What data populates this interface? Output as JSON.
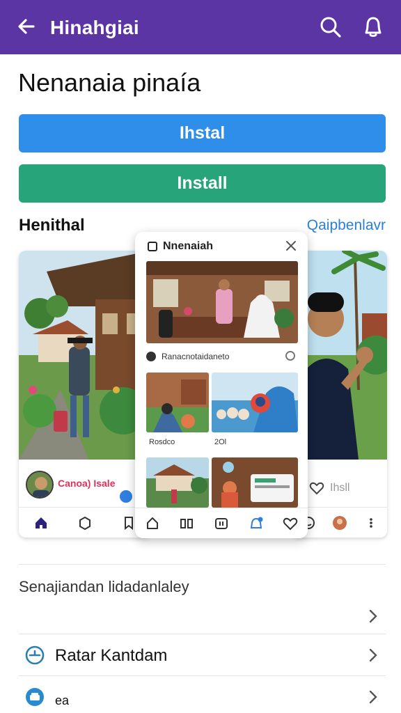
{
  "appbar": {
    "title": "Hinahgiai",
    "background": "#5b35a3",
    "icons": [
      "arrow-left-icon",
      "search-icon",
      "bell-icon"
    ]
  },
  "page": {
    "title": "Nenanaia pinaía"
  },
  "buttons": {
    "primary": {
      "label": "Ihstal",
      "color": "#2f8eea"
    },
    "secondary": {
      "label": "Install",
      "color": "#28a47a"
    }
  },
  "section": {
    "title": "Henithal",
    "link": "Qaipbenlavr"
  },
  "previews": {
    "left": {
      "username": "Canoa) Isale",
      "tab_icons": [
        "home-icon",
        "box-icon",
        "bookmark-icon"
      ]
    },
    "center": {
      "app_name": "Nnenaiah",
      "caption": "Ranacnotaidaneto",
      "tile_labels": [
        "Rosdco",
        "2Ol"
      ],
      "tab_icons": [
        "up-arrow-icon",
        "book-icon",
        "screen-icon",
        "notification-icon",
        "heart-icon"
      ]
    },
    "right": {
      "action_text": "Ihsll",
      "tab_icons": [
        "smile-icon",
        "avatar-icon",
        "more-icon"
      ]
    }
  },
  "list": {
    "header": "Senajiandan lidadanlaley",
    "rows": [
      {
        "label": "",
        "icon": ""
      },
      {
        "label": "Ratar Kantdam",
        "icon": "clock-icon"
      },
      {
        "label": "ea",
        "icon": "car-icon"
      }
    ]
  }
}
